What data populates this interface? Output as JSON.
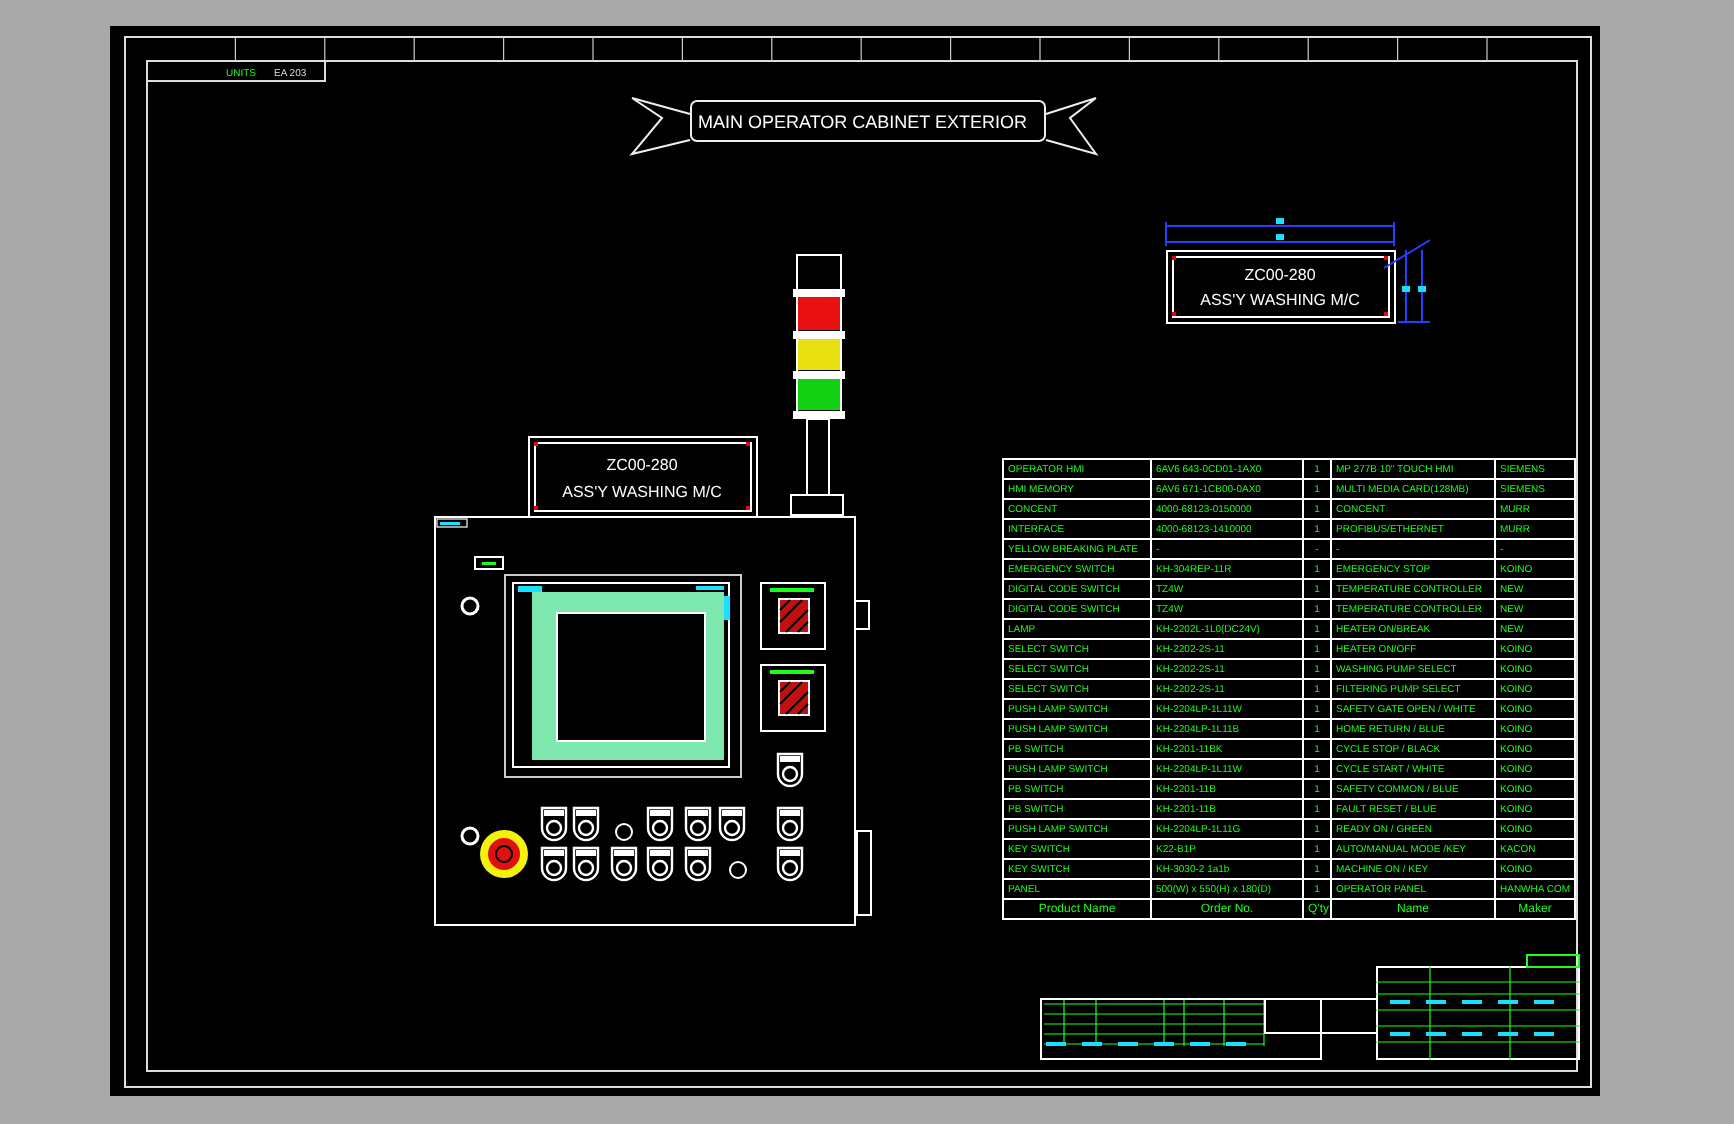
{
  "sheet_label": {
    "caption": "UNITS",
    "value": "EA 203"
  },
  "title": "MAIN OPERATOR CABINET EXTERIOR",
  "nameplates": [
    {
      "line_1": "ZC00-280",
      "line_2": "ASS'Y WASHING M/C"
    },
    {
      "line_1": "ZC00-280",
      "line_2": "ASS'Y WASHING M/C"
    }
  ],
  "parts_table": {
    "rows": [
      [
        "OPERATOR HMI",
        "6AV6 643-0CD01-1AX0",
        "1",
        "MP 277B 10\" TOUCH HMI",
        "SIEMENS"
      ],
      [
        "HMI MEMORY",
        "6AV6 671-1CB00-0AX0",
        "1",
        "MULTI MEDIA CARD(128MB)",
        "SIEMENS"
      ],
      [
        "CONCENT",
        "4000-68123-0150000",
        "1",
        "CONCENT",
        "MURR"
      ],
      [
        "INTERFACE",
        "4000-68123-1410000",
        "1",
        "PROFIBUS/ETHERNET",
        "MURR"
      ],
      [
        "YELLOW BREAKING PLATE",
        "-",
        "-",
        "-",
        "-"
      ],
      [
        "EMERGENCY SWITCH",
        "KH-304REP-11R",
        "1",
        "EMERGENCY STOP",
        "KOINO"
      ],
      [
        "DIGITAL CODE SWITCH",
        "TZ4W",
        "1",
        "TEMPERATURE CONTROLLER",
        "NEW"
      ],
      [
        "DIGITAL CODE SWITCH",
        "TZ4W",
        "1",
        "TEMPERATURE CONTROLLER",
        "NEW"
      ],
      [
        "LAMP",
        "KH-2202L-1L0(DC24V)",
        "1",
        "HEATER ON/BREAK",
        "NEW"
      ],
      [
        "SELECT SWITCH",
        "KH-2202-2S-11",
        "1",
        "HEATER ON/OFF",
        "KOINO"
      ],
      [
        "SELECT SWITCH",
        "KH-2202-2S-11",
        "1",
        "WASHING PUMP SELECT",
        "KOINO"
      ],
      [
        "SELECT SWITCH",
        "KH-2202-2S-11",
        "1",
        "FILTERING PUMP SELECT",
        "KOINO"
      ],
      [
        "PUSH LAMP SWITCH",
        "KH-2204LP-1L11W",
        "1",
        "SAFETY GATE OPEN / WHITE",
        "KOINO"
      ],
      [
        "PUSH LAMP SWITCH",
        "KH-2204LP-1L11B",
        "1",
        "HOME RETURN / BLUE",
        "KOINO"
      ],
      [
        "PB SWITCH",
        "KH-2201-11BK",
        "1",
        "CYCLE STOP / BLACK",
        "KOINO"
      ],
      [
        "PUSH LAMP SWITCH",
        "KH-2204LP-1L11W",
        "1",
        "CYCLE START / WHITE",
        "KOINO"
      ],
      [
        "PB SWITCH",
        "KH-2201-11B",
        "1",
        "SAFETY COMMON / BLUE",
        "KOINO"
      ],
      [
        "PB SWITCH",
        "KH-2201-11B",
        "1",
        "FAULT RESET / BLUE",
        "KOINO"
      ],
      [
        "PUSH LAMP SWITCH",
        "KH-2204LP-1L11G",
        "1",
        "READY ON / GREEN",
        "KOINO"
      ],
      [
        "KEY SWITCH",
        "K22-B1P",
        "1",
        "AUTO/MANUAL MODE /KEY",
        "KACON"
      ],
      [
        "KEY SWITCH",
        "KH-3030-2 1a1b",
        "1",
        "MACHINE ON / KEY",
        "KOINO"
      ],
      [
        "PANEL",
        "500(W) x 550(H) x 180(D)",
        "1",
        "OPERATOR PANEL",
        "HANWHA COM"
      ]
    ],
    "footer_row": [
      "Product Name",
      "Order No.",
      "Q'ty",
      "Name",
      "Maker"
    ]
  }
}
